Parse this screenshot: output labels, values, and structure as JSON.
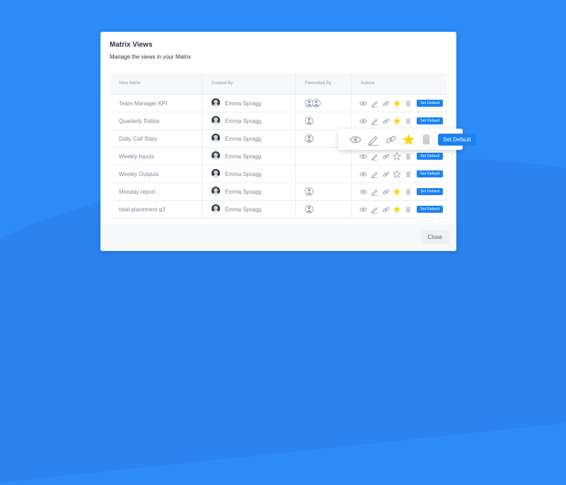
{
  "modal": {
    "title": "Matrix Views",
    "subtitle": "Manage the views in your Matrix",
    "close_label": "Close"
  },
  "table": {
    "columns": [
      "View Name",
      "Created By",
      "Favourited By",
      "Actions"
    ],
    "rows": [
      {
        "name": "Team Manager KPI",
        "creator": "Emma Spragg",
        "fav_count": 2,
        "starred": true
      },
      {
        "name": "Quarterly Ratios",
        "creator": "Emma Spragg",
        "fav_count": 1,
        "starred": true
      },
      {
        "name": "Daily Call Stats",
        "creator": "Emma Spragg",
        "fav_count": 1,
        "starred": true
      },
      {
        "name": "Weekly Inputs",
        "creator": "Emma Spragg",
        "fav_count": 0,
        "starred": false
      },
      {
        "name": "Weekly Outputs",
        "creator": "Emma Spragg",
        "fav_count": 0,
        "starred": false
      },
      {
        "name": "Monday report",
        "creator": "Emma Spragg",
        "fav_count": 1,
        "starred": true
      },
      {
        "name": "total placement q3",
        "creator": "Emma Spragg",
        "fav_count": 1,
        "starred": true
      }
    ],
    "set_default_label": "Set Default"
  },
  "popover": {
    "set_default_label": "Set Default",
    "starred": true
  },
  "icons": [
    "eye-icon",
    "pencil-icon",
    "link-icon",
    "star-icon",
    "trash-icon"
  ],
  "colors": {
    "background": "#2d8cf8",
    "accent": "#1a82f5",
    "star": "#f5d90a",
    "icon_grey": "#a6acb8"
  }
}
